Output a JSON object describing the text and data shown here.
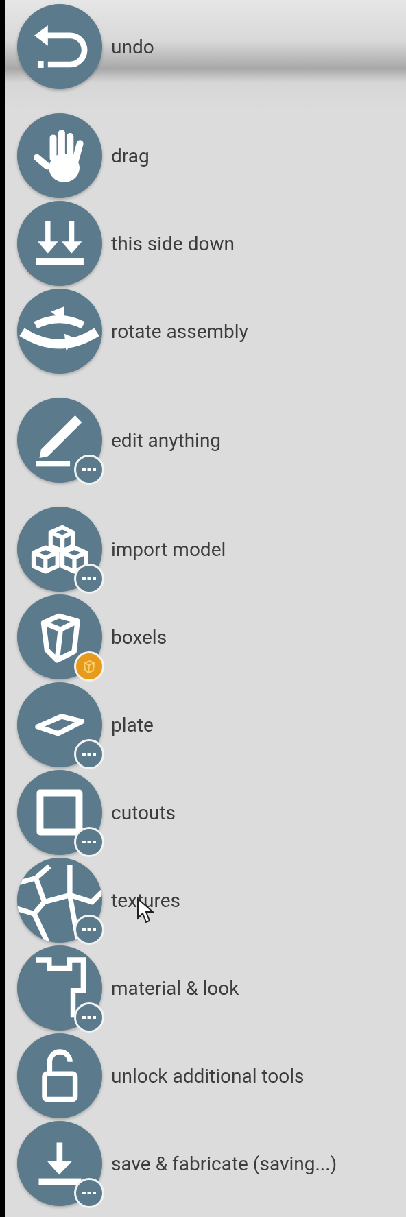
{
  "groups": [
    {
      "tools": [
        {
          "kind": "undo",
          "label": "undo",
          "menu_badge": false,
          "premium_badge": false,
          "pointer": false
        }
      ]
    },
    {
      "tools": [
        {
          "kind": "drag",
          "label": "drag",
          "menu_badge": false,
          "premium_badge": false,
          "pointer": false
        },
        {
          "kind": "down",
          "label": "this side down",
          "menu_badge": false,
          "premium_badge": false,
          "pointer": false
        },
        {
          "kind": "rotate",
          "label": "rotate assembly",
          "menu_badge": false,
          "premium_badge": false,
          "pointer": false
        }
      ]
    },
    {
      "tools": [
        {
          "kind": "edit",
          "label": "edit anything",
          "menu_badge": true,
          "premium_badge": false,
          "pointer": false
        }
      ]
    },
    {
      "tools": [
        {
          "kind": "import",
          "label": "import model",
          "menu_badge": true,
          "premium_badge": false,
          "pointer": false
        },
        {
          "kind": "boxels",
          "label": "boxels",
          "menu_badge": false,
          "premium_badge": true,
          "pointer": false
        },
        {
          "kind": "plate",
          "label": "plate",
          "menu_badge": true,
          "premium_badge": false,
          "pointer": false
        },
        {
          "kind": "cutouts",
          "label": "cutouts",
          "menu_badge": true,
          "premium_badge": false,
          "pointer": false
        },
        {
          "kind": "textures",
          "label": "textures",
          "menu_badge": true,
          "premium_badge": false,
          "pointer": true
        },
        {
          "kind": "material",
          "label": "material & look",
          "menu_badge": true,
          "premium_badge": false,
          "pointer": false
        },
        {
          "kind": "unlock",
          "label": "unlock additional tools",
          "menu_badge": false,
          "premium_badge": false,
          "pointer": false
        },
        {
          "kind": "save",
          "label": "save & fabricate (saving...)",
          "menu_badge": true,
          "premium_badge": false,
          "pointer": false
        }
      ]
    }
  ]
}
